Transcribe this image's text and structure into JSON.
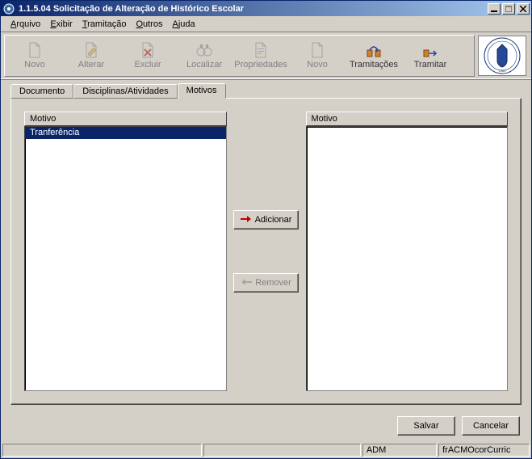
{
  "window": {
    "title": "1.1.5.04 Solicitação de Alteração de Histórico Escolar"
  },
  "menu": {
    "arquivo": "Arquivo",
    "exibir": "Exibir",
    "tramitacao": "Tramitação",
    "outros": "Outros",
    "ajuda": "Ajuda"
  },
  "toolbar": {
    "novo": "Novo",
    "alterar": "Alterar",
    "excluir": "Excluir",
    "localizar": "Localizar",
    "propriedades": "Propriedades",
    "novo2": "Novo",
    "tramitacoes": "Tramitações",
    "tramitar": "Tramitar"
  },
  "tabs": {
    "documento": "Documento",
    "disciplinas": "Disciplinas/Atividades",
    "motivos": "Motivos"
  },
  "panel": {
    "left_header": "Motivo",
    "right_header": "Motivo",
    "left_items": [
      "Tranferência"
    ],
    "right_items": [],
    "add_label": "Adicionar",
    "remove_label": "Remover"
  },
  "buttons": {
    "salvar": "Salvar",
    "cancelar": "Cancelar"
  },
  "status": {
    "cell1": "",
    "cell2": "",
    "cell3": "ADM",
    "cell4": "frACMOcorCurric"
  }
}
